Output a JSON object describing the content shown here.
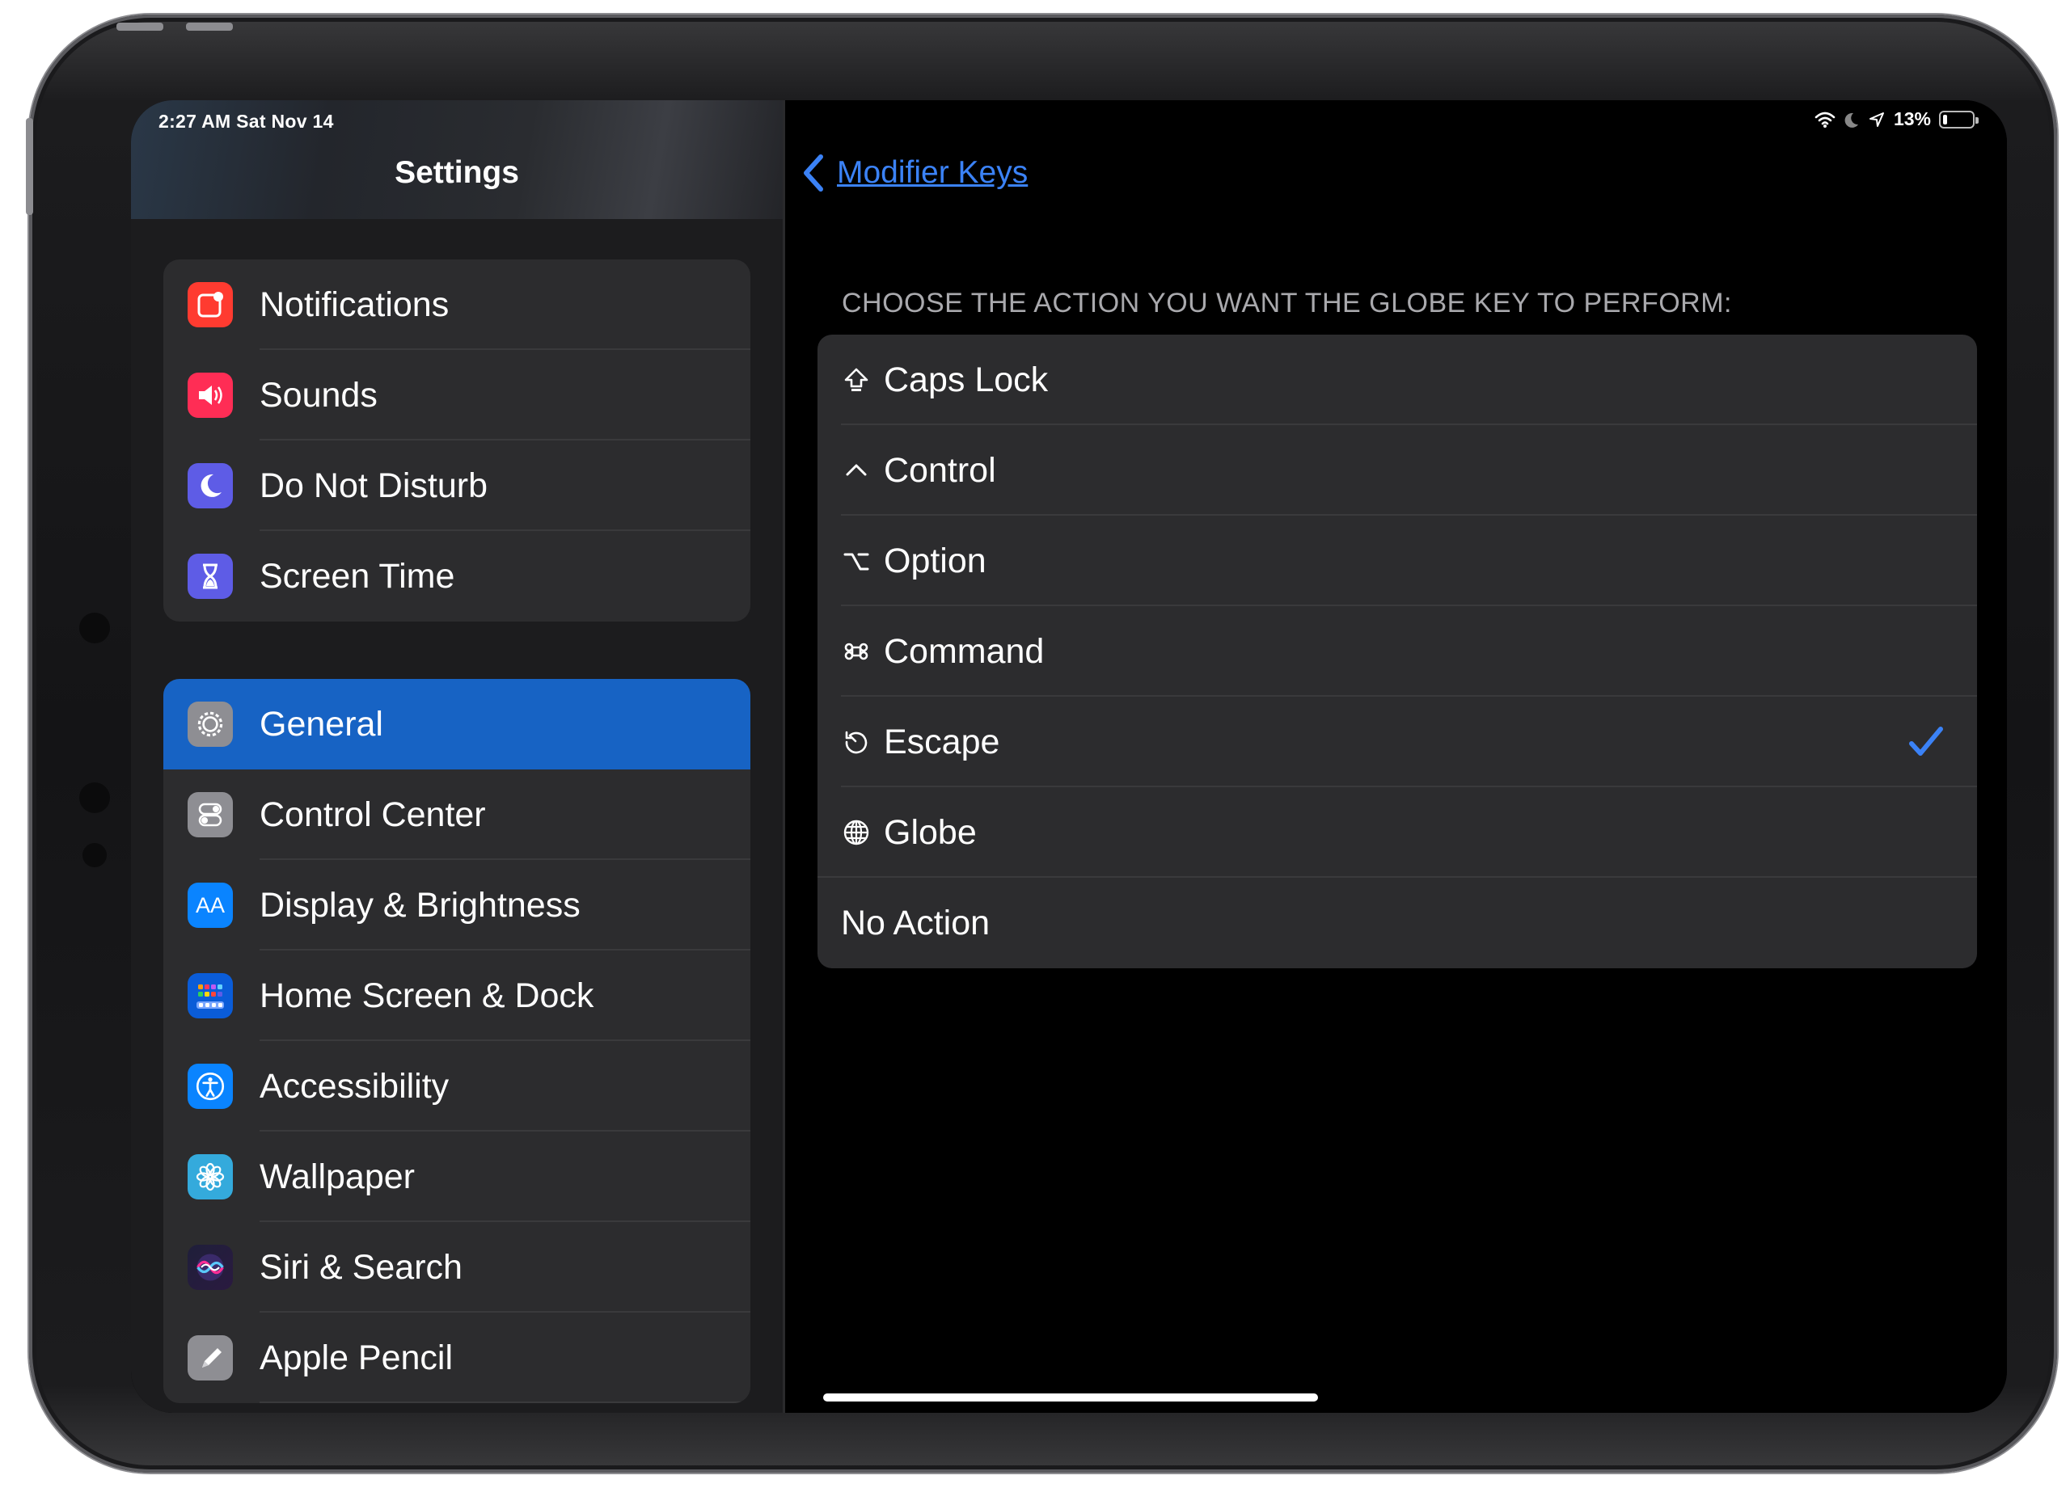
{
  "status_bar": {
    "time": "2:27 AM   Sat Nov 14",
    "battery": "13%"
  },
  "sidebar": {
    "title": "Settings",
    "group1": [
      {
        "label": "Notifications",
        "icon": "notifications-icon",
        "color": "#ff3b30"
      },
      {
        "label": "Sounds",
        "icon": "sounds-icon",
        "color": "#ff2d55"
      },
      {
        "label": "Do Not Disturb",
        "icon": "moon-icon",
        "color": "#5e5ce6"
      },
      {
        "label": "Screen Time",
        "icon": "hourglass-icon",
        "color": "#5e5ce6"
      }
    ],
    "group2": [
      {
        "label": "General",
        "icon": "gear-icon",
        "color": "#8e8e93",
        "selected": true
      },
      {
        "label": "Control Center",
        "icon": "toggles-icon",
        "color": "#8e8e93"
      },
      {
        "label": "Display & Brightness",
        "icon": "text-size-icon",
        "icon_text": "AA",
        "color": "#0a84ff"
      },
      {
        "label": "Home Screen & Dock",
        "icon": "app-grid-icon",
        "color": "#0a5cd8"
      },
      {
        "label": "Accessibility",
        "icon": "accessibility-icon",
        "color": "#0a84ff"
      },
      {
        "label": "Wallpaper",
        "icon": "flower-icon",
        "color": "#34aadc"
      },
      {
        "label": "Siri & Search",
        "icon": "siri-icon",
        "color": "#1c1c1e"
      },
      {
        "label": "Apple Pencil",
        "icon": "pencil-icon",
        "color": "#8e8e93"
      }
    ]
  },
  "detail": {
    "back_label": "Modifier Keys",
    "section_header": "CHOOSE THE ACTION YOU WANT THE GLOBE KEY TO PERFORM:",
    "options": [
      {
        "label": "Caps Lock",
        "icon": "caps-lock-icon",
        "glyph": "⇪"
      },
      {
        "label": "Control",
        "icon": "control-icon",
        "glyph": "^"
      },
      {
        "label": "Option",
        "icon": "option-icon",
        "glyph": "⌥"
      },
      {
        "label": "Command",
        "icon": "command-icon",
        "glyph": "⌘"
      },
      {
        "label": "Escape",
        "icon": "escape-icon",
        "glyph": "⎋",
        "selected": true
      },
      {
        "label": "Globe",
        "icon": "globe-icon",
        "glyph": "🌐"
      },
      {
        "label": "No Action",
        "icon": "",
        "glyph": ""
      }
    ],
    "accent": "#3b82f6"
  }
}
